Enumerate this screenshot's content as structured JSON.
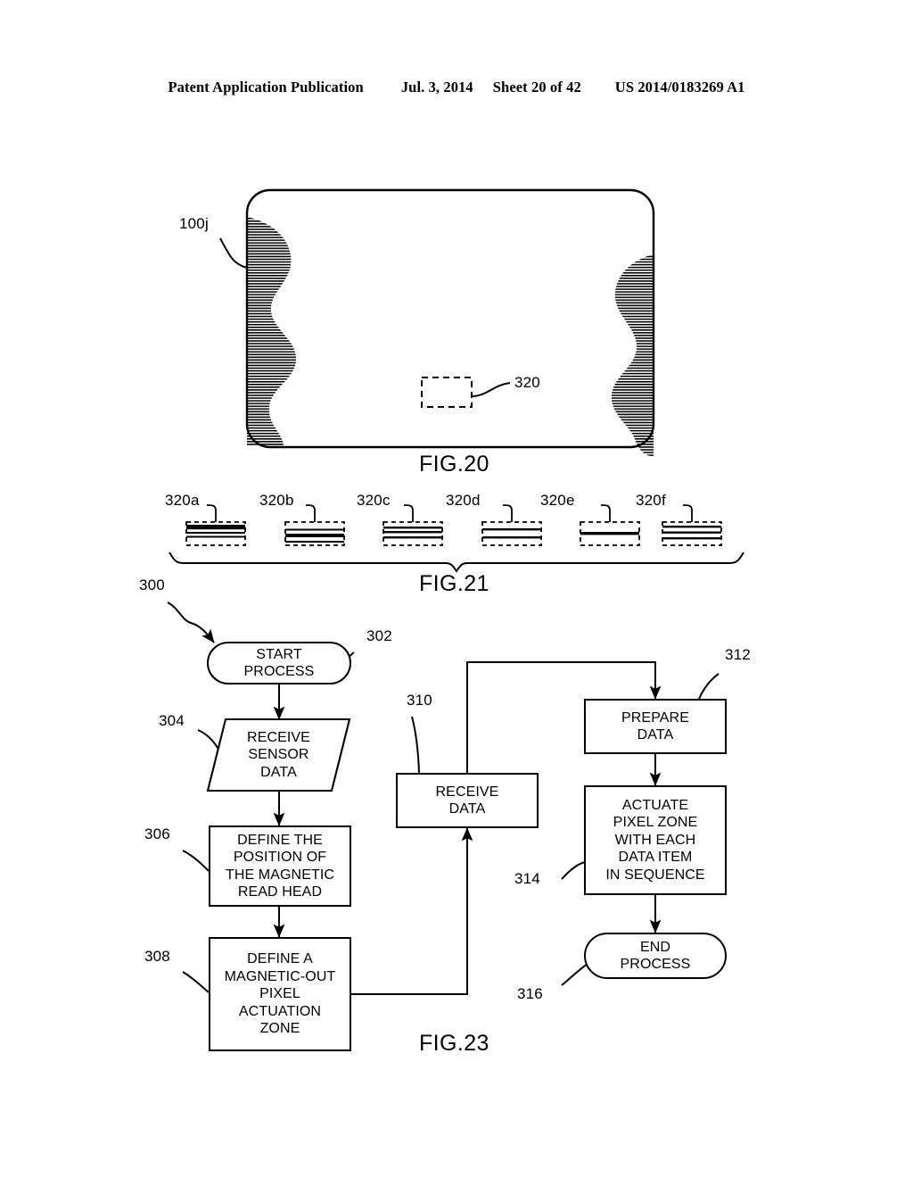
{
  "header": {
    "publication": "Patent Application Publication",
    "date": "Jul. 3, 2014",
    "sheet": "Sheet 20 of 42",
    "patent_number": "US 2014/0183269 A1"
  },
  "fig20": {
    "caption": "FIG.20",
    "device_label": "100j",
    "zone_label": "320"
  },
  "fig21": {
    "caption": "FIG.21",
    "items": [
      {
        "label": "320a",
        "pattern": "thick-top-band-thin-lines"
      },
      {
        "label": "320b",
        "pattern": "two-thin-lines-lower"
      },
      {
        "label": "320c",
        "pattern": "three-lines-upper"
      },
      {
        "label": "320d",
        "pattern": "two-lines-spread"
      },
      {
        "label": "320e",
        "pattern": "single-center-line"
      },
      {
        "label": "320f",
        "pattern": "three-even-lines"
      }
    ]
  },
  "fig23": {
    "caption": "FIG.23",
    "flow_label": "300",
    "nodes": [
      {
        "ref": "302",
        "shape": "terminator",
        "text": "START\nPROCESS"
      },
      {
        "ref": "304",
        "shape": "parallelogram",
        "text": "RECEIVE\nSENSOR\nDATA"
      },
      {
        "ref": "306",
        "shape": "process",
        "text": "DEFINE THE\nPOSITION OF\nTHE MAGNETIC\nREAD HEAD"
      },
      {
        "ref": "308",
        "shape": "process",
        "text": "DEFINE A\nMAGNETIC-OUT\nPIXEL\nACTUATION\nZONE"
      },
      {
        "ref": "310",
        "shape": "process",
        "text": "RECEIVE\nDATA"
      },
      {
        "ref": "312",
        "shape": "process",
        "text": "PREPARE\nDATA"
      },
      {
        "ref": "314",
        "shape": "process",
        "text": "ACTUATE\nPIXEL ZONE\nWITH EACH\nDATA ITEM\nIN SEQUENCE"
      },
      {
        "ref": "316",
        "shape": "terminator",
        "text": "END\nPROCESS"
      }
    ]
  },
  "colors": {
    "ink": "#000000",
    "paper": "#ffffff"
  }
}
